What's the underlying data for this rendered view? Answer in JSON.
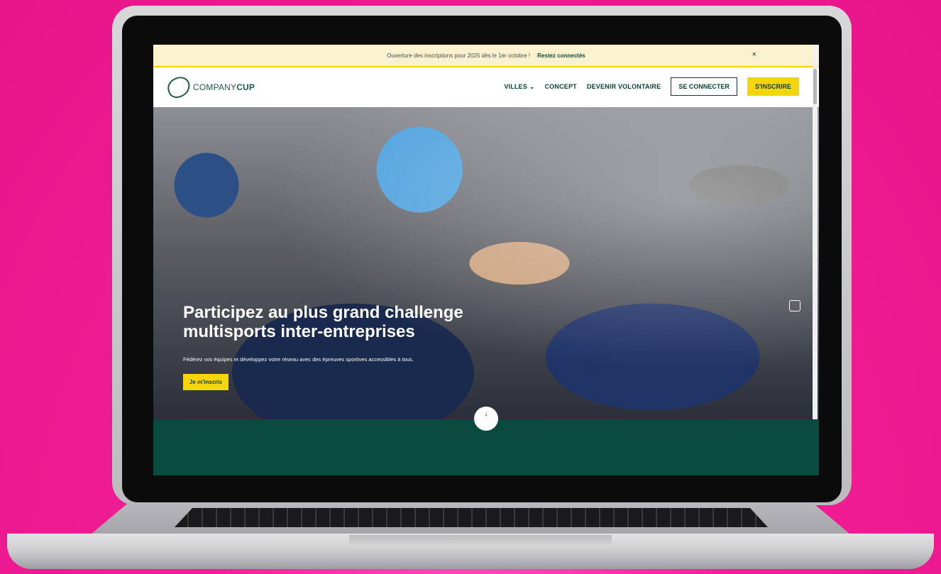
{
  "announcement": {
    "text": "Ouverture des inscriptions pour 2025 dès le 1er octobre !",
    "link": "Restez connectés",
    "close": "×"
  },
  "navbar": {
    "logo_text_light": "COMPANY",
    "logo_text_bold": "CUP",
    "links": [
      {
        "label": "VILLES ⌄"
      },
      {
        "label": "CONCEPT"
      },
      {
        "label": "DEVENIR VOLONTAIRE"
      }
    ],
    "login_button": "SE CONNECTER",
    "register_button": "S'INSCRIRE"
  },
  "hero": {
    "title_line1": "Participez au plus grand challenge",
    "title_line2": "multisports inter-entreprises",
    "subtitle": "Fédérez vos équipes et développez votre réseau avec des épreuves sportives accessibles à tous.",
    "cta": "Je m'inscris",
    "scroll_icon": "↓"
  },
  "colors": {
    "background": "#e8148a",
    "brand_green": "#0a4a3f",
    "brand_yellow": "#f6d50c",
    "announce_bg": "#fbf3cf"
  }
}
